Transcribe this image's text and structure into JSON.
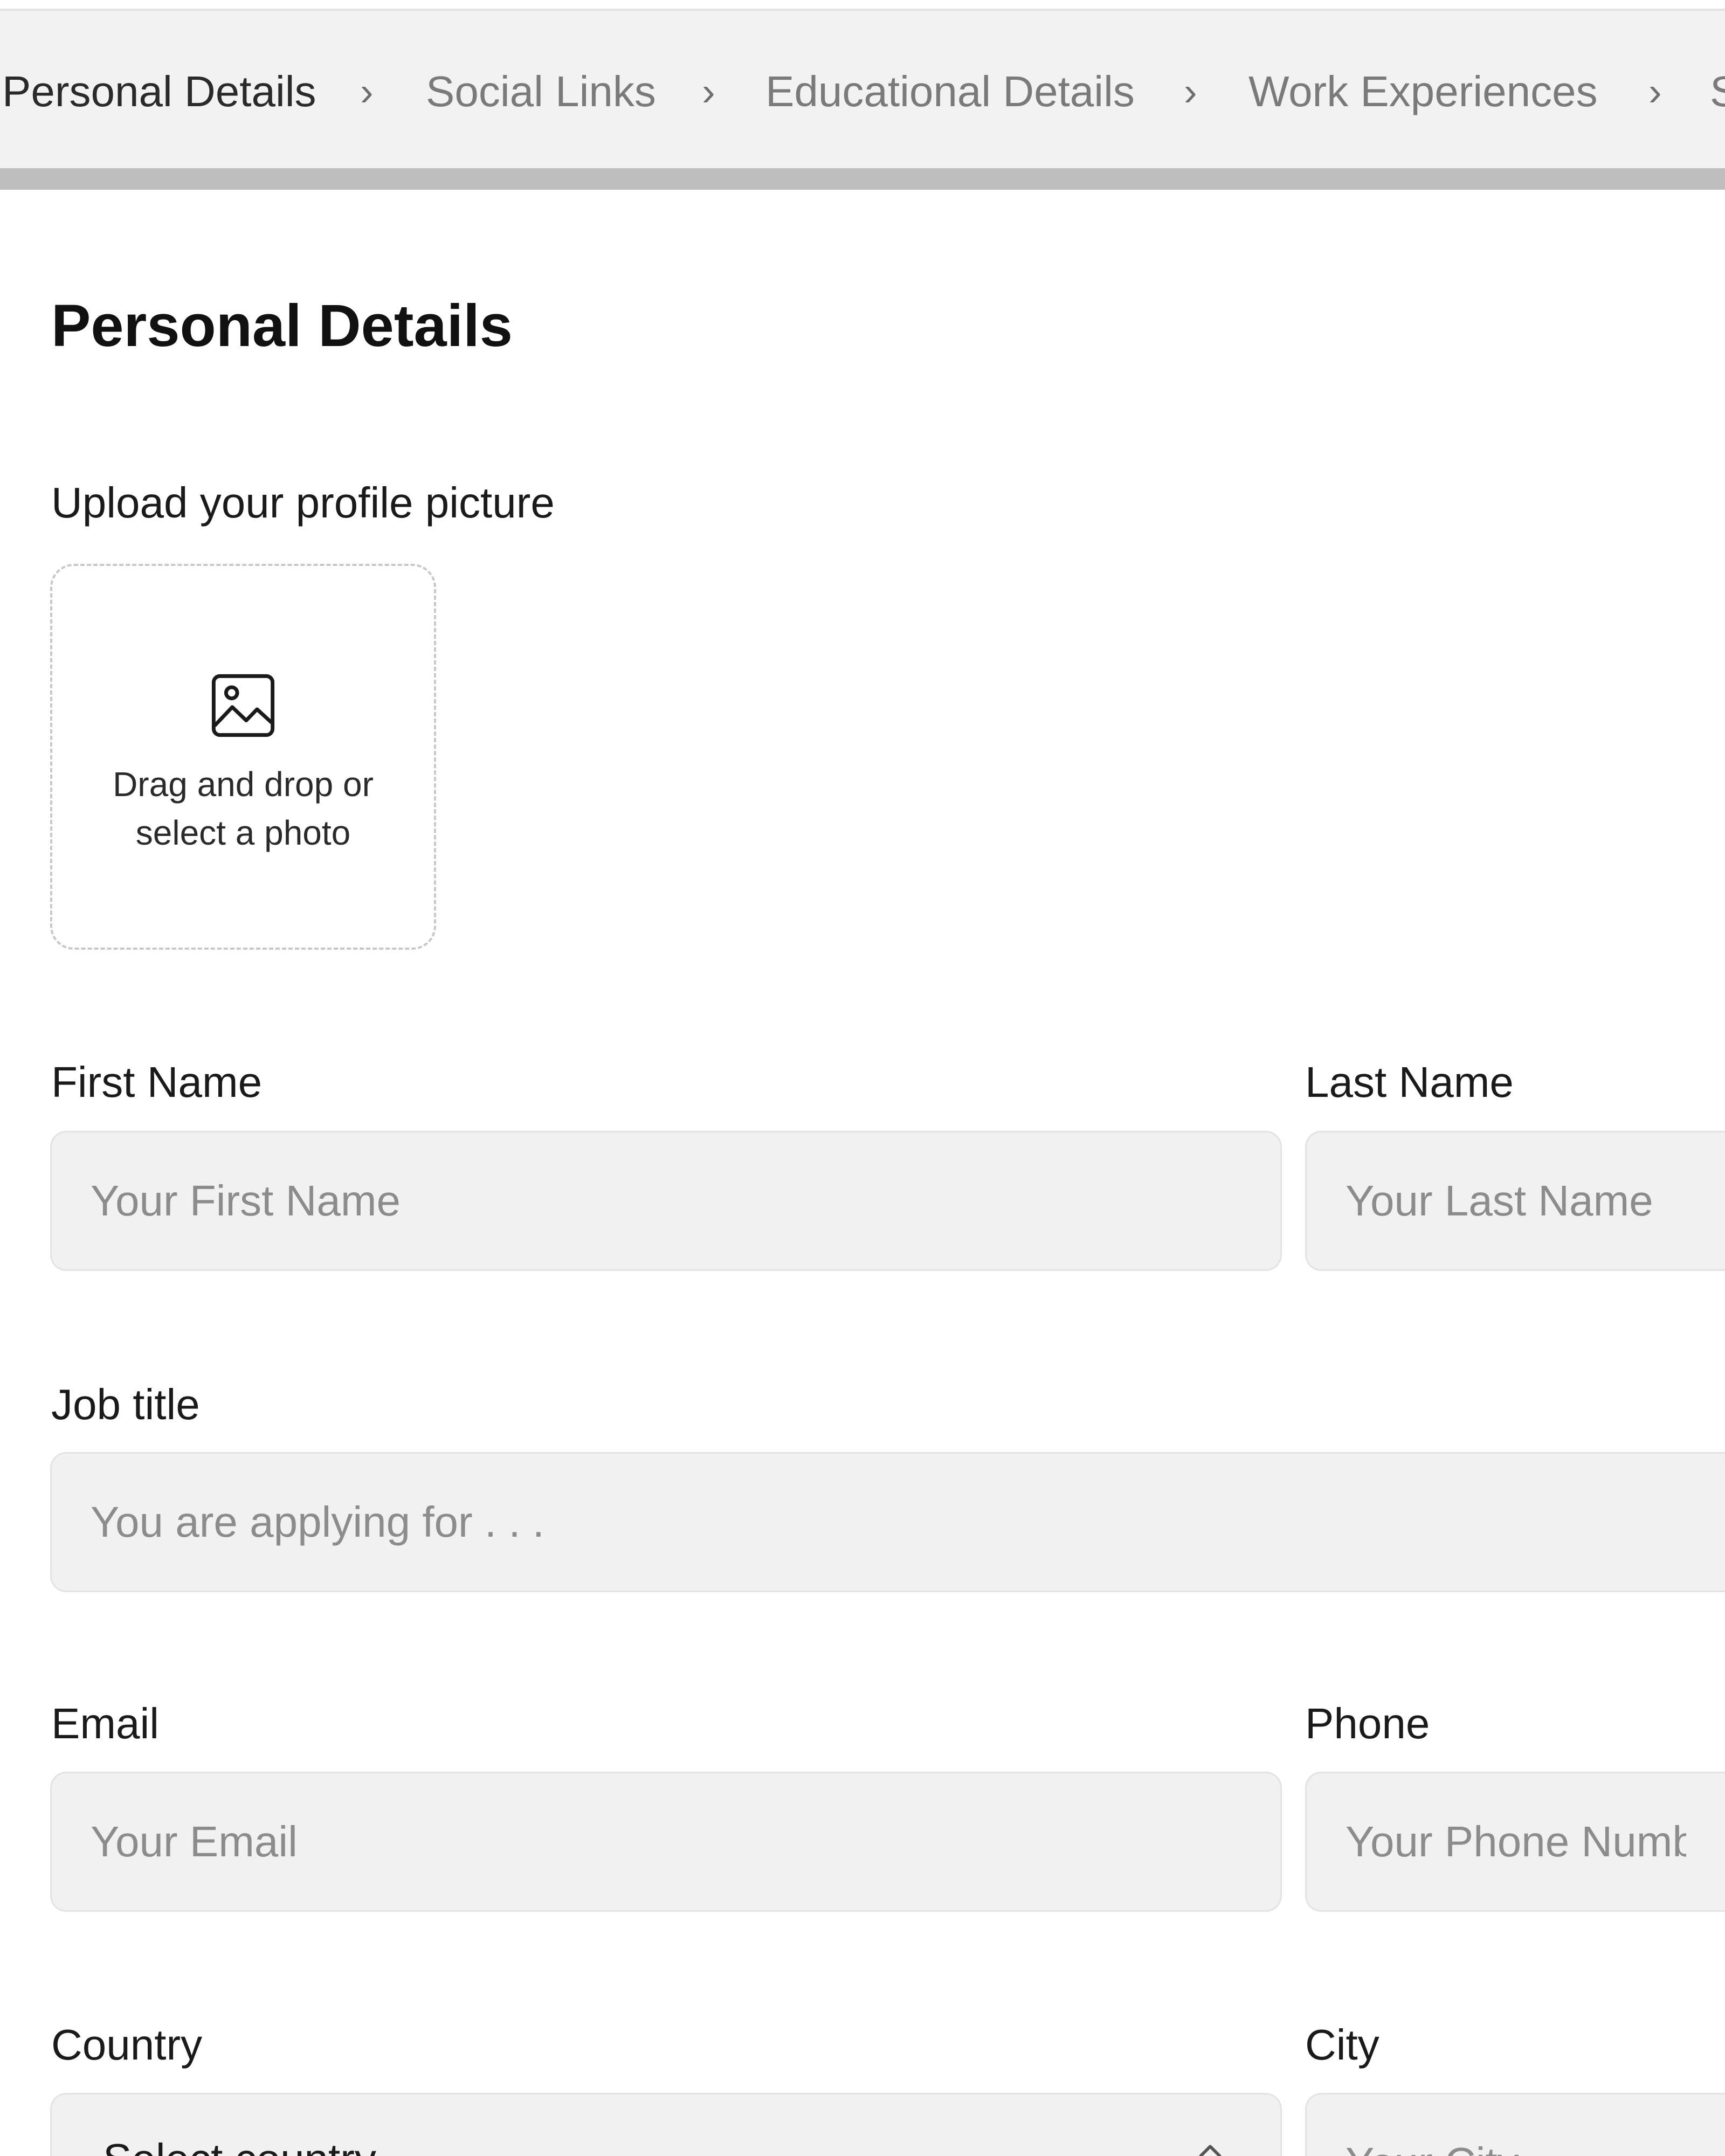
{
  "stepper": {
    "steps": [
      {
        "label": "Personal Details",
        "active": true
      },
      {
        "label": "Social Links",
        "active": false
      },
      {
        "label": "Educational Details",
        "active": false
      },
      {
        "label": "Work Experiences",
        "active": false
      },
      {
        "label": "S",
        "active": false
      }
    ],
    "separator": "›"
  },
  "page": {
    "title": "Personal Details"
  },
  "upload": {
    "label": "Upload your profile picture",
    "line1": "Drag and drop or",
    "line2": "select a photo",
    "icon": "image-icon"
  },
  "fields": {
    "first_name": {
      "label": "First Name",
      "placeholder": "Your First Name",
      "value": ""
    },
    "last_name": {
      "label": "Last Name",
      "placeholder": "Your Last Name",
      "value": ""
    },
    "job_title": {
      "label": "Job title",
      "placeholder": "You are applying for . . .",
      "value": ""
    },
    "email": {
      "label": "Email",
      "placeholder": "Your Email",
      "value": ""
    },
    "phone": {
      "label": "Phone",
      "placeholder": "Your Phone Number",
      "value": ""
    },
    "country": {
      "label": "Country",
      "selected": "Select country",
      "icon": "chevron-up-icon"
    },
    "city": {
      "label": "City",
      "placeholder": "Your City",
      "value": ""
    }
  },
  "colors": {
    "input_bg": "#f1f1f1",
    "stepper_bg": "#f2f2f2",
    "progress": "#bdbdbd",
    "placeholder": "#8c8c8c"
  }
}
